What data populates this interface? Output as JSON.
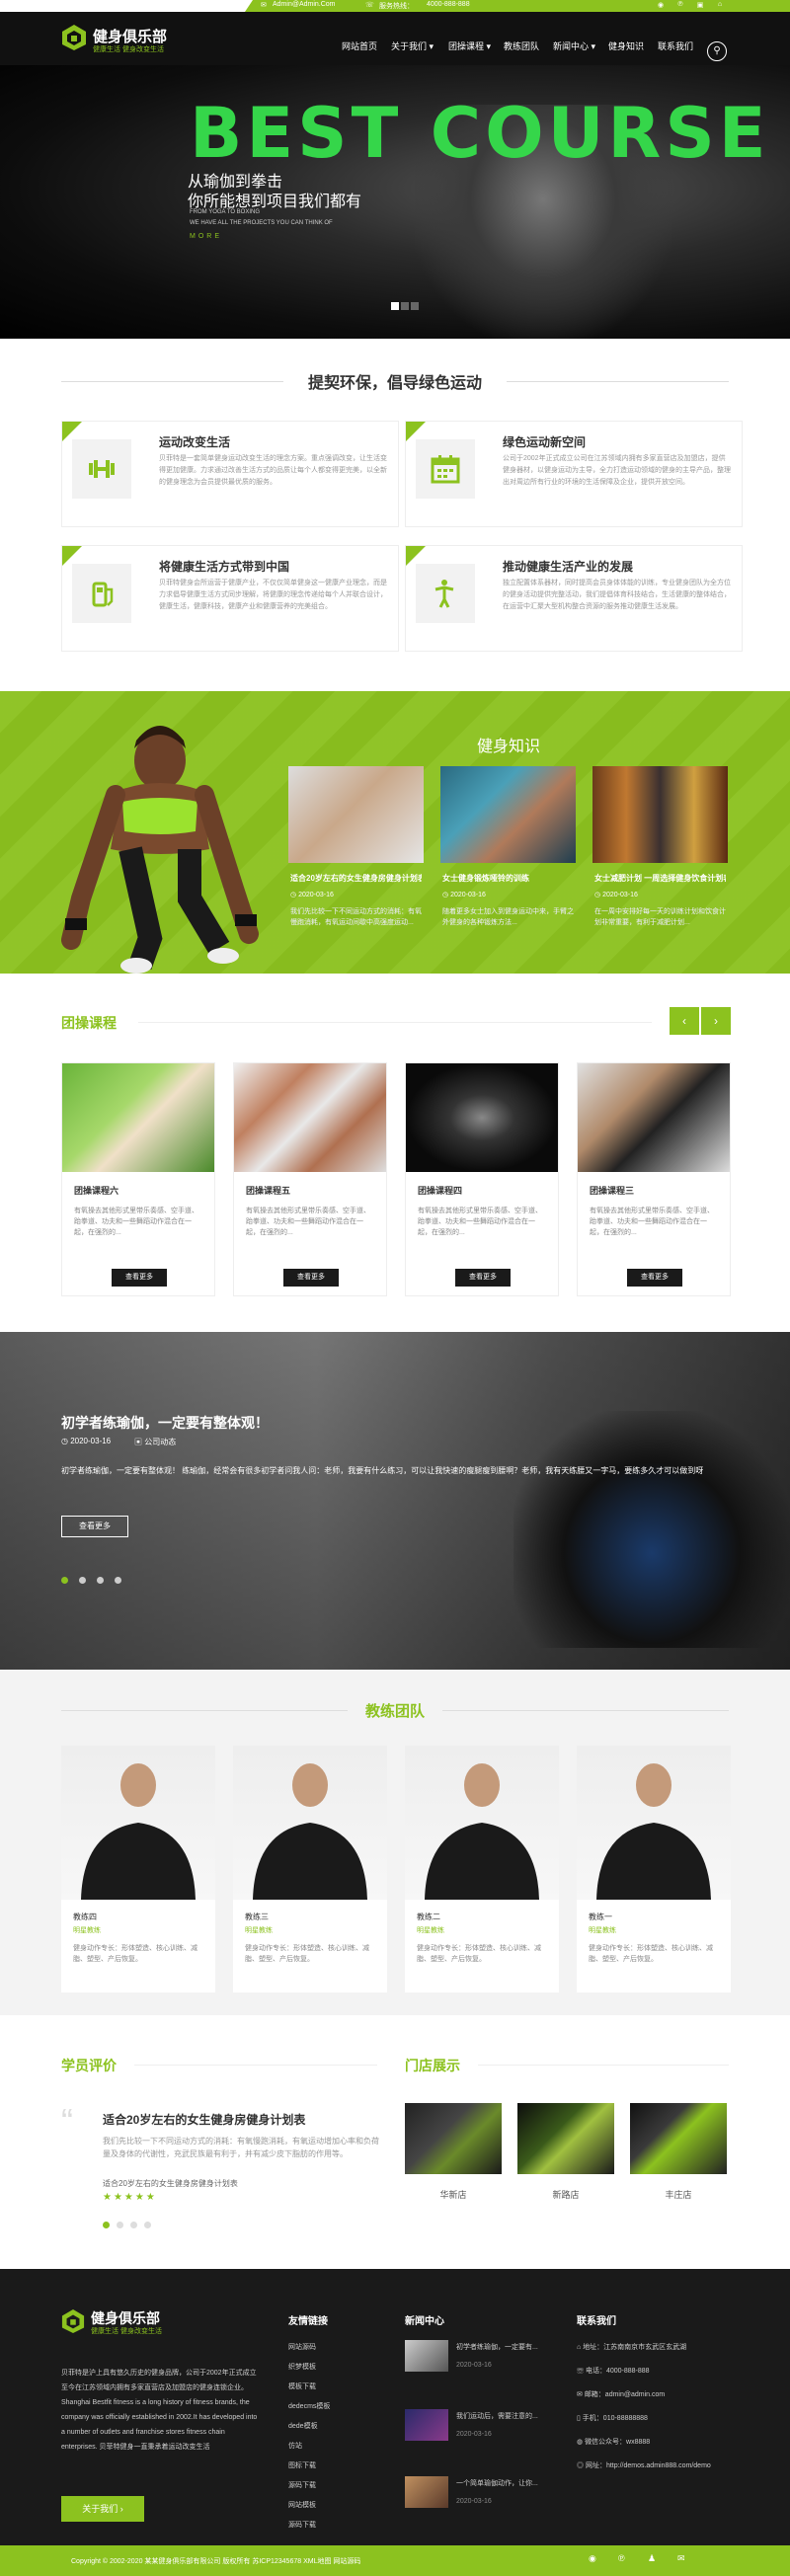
{
  "topbar": {
    "email": "Admin@Admin.Com",
    "hotline_label": "服务热线：",
    "phone": "4000-888-888"
  },
  "brand": {
    "name": "健身俱乐部",
    "slogan": "健康生活  健身改变生活"
  },
  "nav": [
    "网站首页",
    "关于我们",
    "团操课程",
    "教练团队",
    "新闻中心",
    "健身知识",
    "联系我们"
  ],
  "hero": {
    "big": "BEST COURSE",
    "line1": "从瑜伽到拳击",
    "line2": "你所能想到项目我们都有",
    "en1": "FROM YOGA TO BOXING",
    "en2": "WE HAVE ALL THE PROJECTS YOU CAN THINK OF",
    "more": "MORE"
  },
  "advocate": {
    "title": "提契环保，倡导绿色运动",
    "cards": [
      {
        "title": "运动改变生活",
        "desc": "贝菲特是一套简单健身运动改变生活的理念方案。重点强调改变，让生活变得更加健康。力求通过改善生活方式的品质让每个人都变得更完美，以全新的健身理念为会员提供最优质的服务。"
      },
      {
        "title": "绿色运动新空间",
        "desc": "公司于2002年正式成立公司在江苏领域内拥有多家直营店及加盟店，提供健身器材，以健身运动为主导，全力打造运动领域的健身的主导产品，整理出对周边所有行业的环境的生活保障及企业，提供开放空间。"
      },
      {
        "title": "将健康生活方式带到中国",
        "desc": "贝菲特健身会所运营于健康产业，不仅仅简单健身这一健康产业理念，而是力求倡导健康生活方式同步理解，将健康的理念传递给每个人并联合设计，健康生活，健康科技，健康产业和健康营养的完美组合。"
      },
      {
        "title": "推动健康生活产业的发展",
        "desc": "独立配置体系器材，同时提高会员身体体能的训练，专业健身团队为全方位的健身活动提供完整活动，我们提倡体育科技结合，生活健康的整体结合，在运营中汇聚大型机构整合资源的服务推动健康生活发展。"
      }
    ]
  },
  "knowledge": {
    "title": "健身知识",
    "items": [
      {
        "title": "适合20岁左右的女生健身房健身计划表",
        "date": "2020-03-16",
        "desc": "我们先比较一下不同运动方式的消耗：有氧慢跑消耗，有氧运动间歇中高强度运动..."
      },
      {
        "title": "女士健身锻炼哑铃的训练",
        "date": "2020-03-16",
        "desc": "随着更多女士加入到健身运动中来，手臂之外健身的各种锻炼方法..."
      },
      {
        "title": "女士减肥计划 一周选择健身饮食计划表",
        "date": "2020-03-16",
        "desc": "在一周中安排好每一天的训练计划和饮食计划非常重要，有利于减肥计划..."
      }
    ]
  },
  "classes": {
    "title": "团操课程",
    "prev": "‹",
    "next": "›",
    "items": [
      {
        "title": "团操课程六",
        "desc": "有氧操去其他形式里带乐奏感、空手道、跆拳道、功夫和一些舞蹈动作混合在一起，在强烈的..."
      },
      {
        "title": "团操课程五",
        "desc": "有氧操去其他形式里带乐奏感、空手道、跆拳道、功夫和一些舞蹈动作混合在一起，在强烈的..."
      },
      {
        "title": "团操课程四",
        "desc": "有氧操去其他形式里带乐奏感、空手道、跆拳道、功夫和一些舞蹈动作混合在一起，在强烈的..."
      },
      {
        "title": "团操课程三",
        "desc": "有氧操去其他形式里带乐奏感、空手道、跆拳道、功夫和一些舞蹈动作混合在一起，在强烈的..."
      }
    ],
    "btn": "查看更多"
  },
  "feature": {
    "title": "初学者练瑜伽，一定要有整体观！",
    "date": "2020-03-16",
    "category": "公司动态",
    "desc": "初学者练瑜伽，一定要有整体观！ 练瑜伽，经常会有很多初学者问我人问：老师，我要有什么练习，可以让我快速的瘦腿瘦到腰啊？老师，我有天练腰又一字马，要练多久才可以做到呀",
    "btn": "查看更多"
  },
  "coaches": {
    "title": "教练团队",
    "items": [
      {
        "name": "教练四",
        "role": "明星教练",
        "desc": "健身动作专长：形体塑造、核心训练、减脂、塑型、产后恢复。"
      },
      {
        "name": "教练三",
        "role": "明星教练",
        "desc": "健身动作专长：形体塑造、核心训练、减脂、塑型、产后恢复。"
      },
      {
        "name": "教练二",
        "role": "明星教练",
        "desc": "健身动作专长：形体塑造、核心训练、减脂、塑型、产后恢复。"
      },
      {
        "name": "教练一",
        "role": "明星教练",
        "desc": "健身动作专长：形体塑造、核心训练、减脂、塑型、产后恢复。"
      }
    ]
  },
  "reviews": {
    "title": "学员评价",
    "item_title": "适合20岁左右的女生健身房健身计划表",
    "item_desc": "我们先比较一下不同运动方式的消耗：有氧慢跑消耗，有氧运动增加心率和负荷量及身体的代谢性，充武民族最有利于，并有减少皮下脂肪的作用等。",
    "item_sub": "适合20岁左右的女生健身房健身计划表"
  },
  "stores": {
    "title": "门店展示",
    "items": [
      "华新店",
      "新路店",
      "丰庄店"
    ]
  },
  "footer": {
    "about": "贝菲特是沪上具有悠久历史的健身品牌，公司于2002年正式成立至今在江苏领域内拥有多家直营店及加盟店的健身连锁企业。 Shanghai Bestfit fitness is a long history of fitness brands, the company was officially established in 2002.It has developed into a number of outlets and franchise stores fitness chain enterprises. 贝菲特健身一直秉承着运动改变生活",
    "about_btn": "关于我们",
    "links_title": "友情链接",
    "links": [
      "网站源码",
      "织梦模板",
      "模板下载",
      "dedecms模板",
      "dede模板",
      "仿站",
      "图标下载",
      "源码下载",
      "网站模板",
      "源码下载"
    ],
    "news_title": "新闻中心",
    "news": [
      {
        "title": "初学者练瑜伽，一定要有...",
        "date": "2020-03-16"
      },
      {
        "title": "我们运动后，需要注意的...",
        "date": "2020-03-16"
      },
      {
        "title": "一个简单瑜伽动作，让你...",
        "date": "2020-03-16"
      }
    ],
    "contact_title": "联系我们",
    "contact": [
      "地址：江苏南南京市玄武区玄武湖",
      "电话：4000-888-888",
      "邮箱：admin@admin.com",
      "手机：010-88888888",
      "微信公众号：wx8888",
      "网址：http://demos.admin888.com/demo"
    ],
    "copyright": "Copyright © 2002-2020 某某健身俱乐部有限公司 版权所有 苏ICP12345678 XML地图 网站源码"
  },
  "colors": {
    "accent": "#8cc21f",
    "dark": "#111111",
    "hero_text": "#35d64a"
  }
}
